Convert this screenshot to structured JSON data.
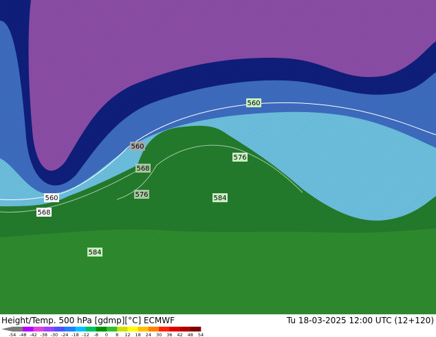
{
  "title": {
    "left": "Height/Temp. 500 hPa [gdmp][°C] ECMWF",
    "right": "Tu 18-03-2025 12:00 UTC (12+120)"
  },
  "contour_labels": [
    "560",
    "560",
    "576",
    "568",
    "576",
    "584",
    "560",
    "568",
    "584"
  ],
  "colorbar": {
    "ticks": [
      "-54",
      "-48",
      "-42",
      "-38",
      "-30",
      "-24",
      "-18",
      "-12",
      "-8",
      "0",
      "8",
      "12",
      "18",
      "24",
      "30",
      "36",
      "42",
      "48",
      "54"
    ],
    "colors": [
      "#7a7a7a",
      "#b400ff",
      "#e040e0",
      "#a040ff",
      "#5050ff",
      "#2080ff",
      "#00c0ff",
      "#00c060",
      "#009000",
      "#30c030",
      "#d0e000",
      "#ffff00",
      "#ffc000",
      "#ff8000",
      "#ff2000",
      "#e00000",
      "#b00000",
      "#800000"
    ]
  },
  "colors": {
    "cold_pool": "#8a4aa6",
    "trough": "#0a1a7a",
    "mid_blue": "#3a6ac0",
    "light_blue": "#6ac0e0",
    "ridge_green": "#1f7a28",
    "warm_green": "#2a8a2a"
  }
}
